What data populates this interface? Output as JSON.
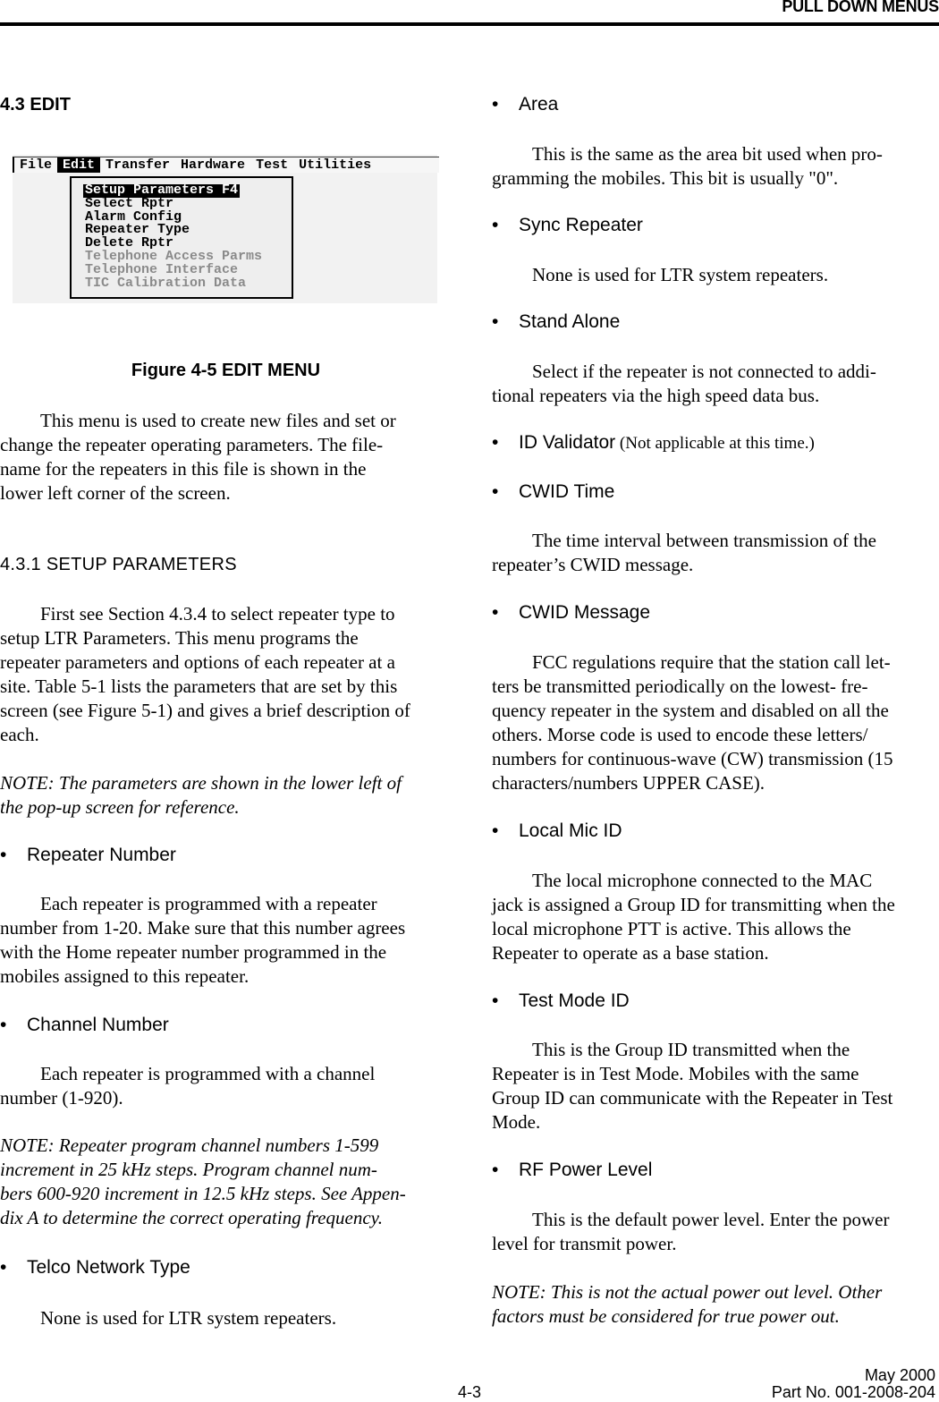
{
  "header": {
    "running_title": "PULL DOWN MENUS"
  },
  "section": {
    "number_title": "4.3 EDIT"
  },
  "figure": {
    "menubar": [
      {
        "label": "File",
        "active": false
      },
      {
        "label": "Edit",
        "active": true
      },
      {
        "label": "Transfer",
        "active": false
      },
      {
        "label": "Hardware",
        "active": false
      },
      {
        "label": "Test",
        "active": false
      },
      {
        "label": "Utilities",
        "active": false
      }
    ],
    "dropdown": [
      {
        "label": "Setup Parameters F4",
        "state": "selected"
      },
      {
        "label": "Select Rptr",
        "state": "enabled"
      },
      {
        "label": "Alarm Config",
        "state": "enabled"
      },
      {
        "label": "Repeater Type",
        "state": "enabled"
      },
      {
        "label": "Delete Rptr",
        "state": "enabled"
      },
      {
        "label": "Telephone Access Parms",
        "state": "disabled"
      },
      {
        "label": "Telephone Interface",
        "state": "disabled"
      },
      {
        "label": "TIC Calibration Data",
        "state": "disabled"
      }
    ],
    "caption": "Figure 4-5   EDIT MENU"
  },
  "intro": {
    "lines": [
      "This menu is used to create new files and set or",
      "change the repeater operating parameters.  The file-",
      "name for the repeaters in this file is shown in the",
      "lower left corner of the screen."
    ]
  },
  "subsection": {
    "title": "4.3.1  SETUP PARAMETERS",
    "para_lines": [
      "First see Section 4.3.4 to select repeater type to",
      "setup LTR Parameters.  This menu programs the",
      "repeater parameters and options of each repeater at a",
      "site.  Table 5-1 lists the parameters that are set by this",
      "screen (see Figure 5-1) and gives a brief description of",
      "each."
    ],
    "note_lines": [
      "NOTE: The parameters are shown in the lower left of",
      "the pop-up screen for reference."
    ]
  },
  "left_items": [
    {
      "bullet": "•",
      "title": "Repeater Number",
      "lines": [
        "Each repeater is programmed with a repeater",
        "number from 1-20.  Make sure that this number agrees",
        "with the Home repeater number programmed in the",
        "mobiles assigned to this repeater."
      ]
    },
    {
      "bullet": "•",
      "title": "Channel Number",
      "lines": [
        "Each repeater is programmed with a channel",
        "number  (1-920)."
      ],
      "note_lines": [
        "NOTE:  Repeater program channel numbers 1-599",
        "increment in 25 kHz steps.  Program channel num-",
        "bers 600-920 increment in 12.5 kHz steps.  See Appen-",
        "dix A to determine the correct operating frequency."
      ]
    },
    {
      "bullet": "•",
      "title": "Telco Network Type",
      "lines": [
        "None is used for LTR system repeaters."
      ]
    }
  ],
  "right_items": [
    {
      "bullet": "•",
      "title": "Area",
      "lines": [
        "This is the same as the area bit used when pro-",
        "gramming the mobiles.  This bit is usually \"0\"."
      ]
    },
    {
      "bullet": "•",
      "title": "Sync Repeater",
      "lines": [
        "None is used for LTR system repeaters."
      ]
    },
    {
      "bullet": "•",
      "title": "Stand Alone",
      "lines": [
        "Select if the repeater is not connected to addi-",
        "tional repeaters via the high speed data bus."
      ]
    },
    {
      "bullet": "•",
      "title": "ID Validator",
      "title_suffix": " (Not applicable at this time.)"
    },
    {
      "bullet": "•",
      "title": "CWID Time",
      "lines": [
        "The time interval between transmission of the",
        "repeater’s CWID message."
      ]
    },
    {
      "bullet": "•",
      "title": "CWID Message",
      "lines": [
        "FCC regulations require that the station call let-",
        "ters be transmitted periodically on the lowest- fre-",
        "quency repeater in the system and disabled on all the",
        "others.  Morse code is used to encode these letters/",
        "numbers for continuous-wave (CW) transmission (15",
        "characters/numbers UPPER CASE)."
      ]
    },
    {
      "bullet": "•",
      "title": "Local Mic ID",
      "lines": [
        "The local microphone connected to the MAC",
        "jack is assigned a Group ID for transmitting when the",
        "local microphone PTT is active.  This allows the",
        "Repeater to operate as a base station."
      ]
    },
    {
      "bullet": "•",
      "title": "Test Mode ID",
      "lines": [
        "This is the Group ID transmitted when the",
        "Repeater is in Test Mode.  Mobiles with the same",
        "Group ID can communicate with the Repeater in Test",
        "Mode."
      ]
    },
    {
      "bullet": "•",
      "title": "RF Power Level",
      "lines": [
        "This is the default power level.  Enter the power",
        "level for transmit power."
      ],
      "note_lines": [
        "NOTE:  This is not the actual power out level.  Other",
        "factors must be considered for true power out."
      ]
    }
  ],
  "footer": {
    "date": "May 2000",
    "page": "4-3",
    "part_no": "Part No. 001-2008-204"
  }
}
